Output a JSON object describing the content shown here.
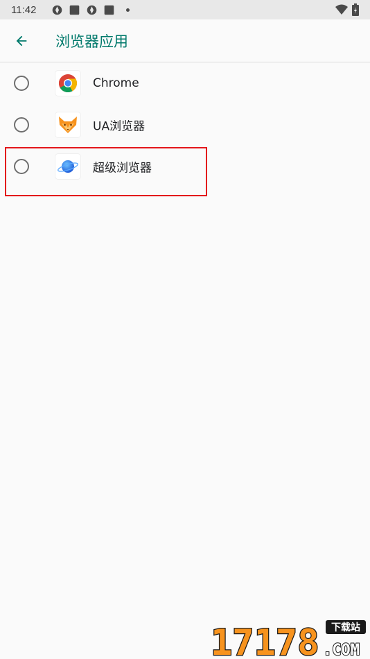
{
  "status_bar": {
    "time": "11:42"
  },
  "app_bar": {
    "title": "浏览器应用",
    "back_icon": "arrow-back-icon"
  },
  "browsers": [
    {
      "name": "Chrome",
      "icon": "chrome-icon",
      "selected": false
    },
    {
      "name": "UA浏览器",
      "icon": "ua-fox-icon",
      "selected": false
    },
    {
      "name": "超级浏览器",
      "icon": "planet-icon",
      "selected": false
    }
  ],
  "colors": {
    "accent": "#00796b",
    "highlight": "#e3161b",
    "radio": "#6f6f6f",
    "watermark_orange": "#f7931e"
  },
  "watermark": {
    "number": "17178",
    "badge": "下载站",
    "suffix": ".COM"
  }
}
